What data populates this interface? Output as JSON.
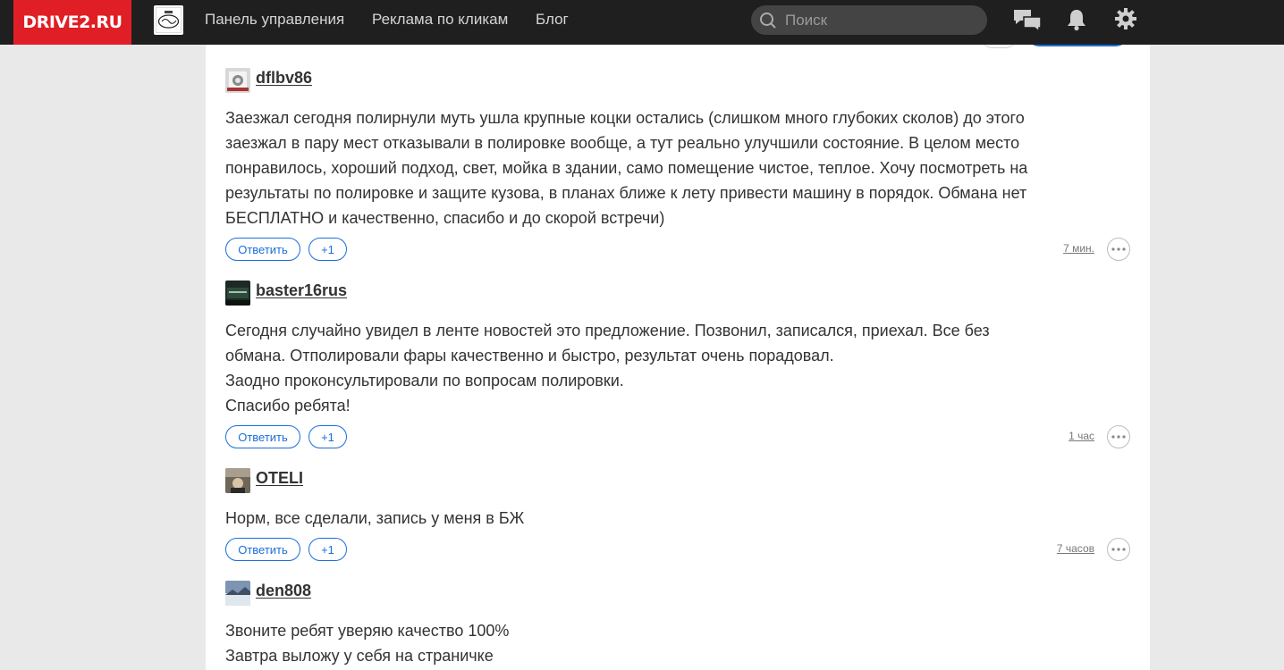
{
  "header": {
    "logo": "DRIVE2.RU",
    "nav": [
      "Панель управления",
      "Реклама по кликам",
      "Блог"
    ],
    "search_placeholder": "Поиск"
  },
  "comments": [
    {
      "author": "dflbv86",
      "lines": [
        "Заезжал сегодня полирнули муть ушла крупные коцки остались (слишком много глубоких сколов) до этого заезжал в пару мест отказывали в полировке вообще, а тут реально улучшили состояние. В целом место понравилось, хороший подход, свет, мойка в здании, само помещение чистое, теплое. Хочу посмотреть на результаты по полировке и защите кузова, в планах ближе к лету привести машину в порядок. Обмана нет БЕСПЛАТНО и качественно, спасибо и до скорой встречи)"
      ],
      "reply_label": "Ответить",
      "plus_label": "+1",
      "time": "7 мин."
    },
    {
      "author": "baster16rus",
      "lines": [
        "Сегодня случайно увидел в ленте новостей это предложение. Позвонил, записался, приехал. Все без обмана. Отполировали фары качественно и быстро, результат очень порадовал.",
        "Заодно проконсультировали по вопросам полировки.",
        "Спасибо ребята!"
      ],
      "reply_label": "Ответить",
      "plus_label": "+1",
      "time": "1 час"
    },
    {
      "author": "OTELI",
      "lines": [
        "Норм, все сделали, запись у меня в БЖ"
      ],
      "reply_label": "Ответить",
      "plus_label": "+1",
      "time": "7 часов"
    },
    {
      "author": "den808",
      "lines": [
        "Звоните ребят уверяю качество 100%",
        "Завтра выложу у себя на страничке"
      ]
    }
  ],
  "colors": {
    "brand_red": "#e01e25",
    "topbar": "#1f1f1f",
    "accent_blue": "#1a6fd9",
    "text": "#333333"
  },
  "icons": [
    "search-icon",
    "messages-icon",
    "bell-icon",
    "gear-icon",
    "more-icon",
    "camera-icon"
  ]
}
